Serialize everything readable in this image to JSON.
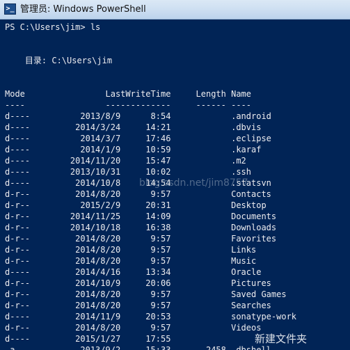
{
  "window": {
    "title": "管理员: Windows PowerShell",
    "icon": "powershell-icon",
    "icon_glyph": ">_"
  },
  "colors": {
    "console_background": "#012456",
    "console_text": "#eeedf0",
    "titlebar": "#cfe0f2"
  },
  "console": {
    "prompt_line": "PS C:\\Users\\jim> ls",
    "directory_line": "    目录: C:\\Users\\jim",
    "header_line": "Mode                LastWriteTime     Length Name",
    "separator_line": "----                -------------     ------ ----",
    "rows": [
      "d----          2013/8/9      8:54            .android",
      "d----         2014/3/24     14:21            .dbvis",
      "d----          2014/3/7     17:46            .eclipse",
      "d----          2014/1/9     10:59            .karaf",
      "d----        2014/11/20     15:47            .m2",
      "d----        2013/10/31     10:02            .ssh",
      "d----         2014/10/8     14:54            .statsvn",
      "d-r--         2014/8/20      9:57            Contacts",
      "d-r--          2015/2/9     20:31            Desktop",
      "d-r--        2014/11/25     14:09            Documents",
      "d-r--        2014/10/18     16:38            Downloads",
      "d-r--         2014/8/20      9:57            Favorites",
      "d-r--         2014/8/20      9:57            Links",
      "d-r--         2014/8/20      9:57            Music",
      "d----         2014/4/16     13:34            Oracle",
      "d-r--         2014/10/9     20:06            Pictures",
      "d-r--         2014/8/20      9:57            Saved Games",
      "d-r--         2014/8/20      9:57            Searches",
      "d----         2014/11/9     20:53            sonatype-work",
      "d-r--         2014/8/20      9:57            Videos",
      "d----         2015/1/27     17:55            "
    ],
    "partial_row": "-a---          2013/9/2     15:33       2458 .dbshell"
  },
  "watermark": {
    "url": "blog.csdn.net/jim8757",
    "label": "新建文件夹"
  }
}
